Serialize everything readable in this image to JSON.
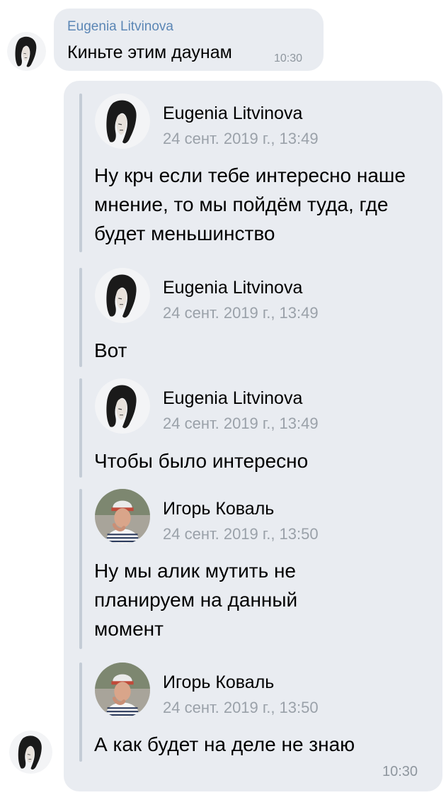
{
  "top_message": {
    "sender": "Eugenia Litvinova",
    "text": "Киньте этим даунам",
    "time": "10:30",
    "avatar_icon": "avatar-woman-photo"
  },
  "forwarded_message": {
    "time": "10:30",
    "items": [
      {
        "name": "Eugenia Litvinova",
        "date": "24 сент. 2019 г., 13:49",
        "text": "Ну крч если тебе интересно наше мнение, то мы пойдём туда, где будет меньшинство",
        "avatar_icon": "avatar-woman-photo"
      },
      {
        "name": "Eugenia Litvinova",
        "date": "24 сент. 2019 г., 13:49",
        "text": "Вот",
        "avatar_icon": "avatar-woman-photo"
      },
      {
        "name": "Eugenia Litvinova",
        "date": "24 сент. 2019 г., 13:49",
        "text": "Чтобы было интересно",
        "avatar_icon": "avatar-woman-photo"
      },
      {
        "name": "Игорь Коваль",
        "date": "24 сент. 2019 г., 13:50",
        "text": "Ну мы алик мутить не планируем на данный момент",
        "avatar_icon": "avatar-man-photo"
      },
      {
        "name": "Игорь Коваль",
        "date": "24 сент. 2019 г., 13:50",
        "text": "А как будет на деле не знаю",
        "avatar_icon": "avatar-man-photo"
      }
    ]
  },
  "colors": {
    "bubble": "#e9ecf1",
    "sender_link": "#5b86b5",
    "meta_gray": "#9aa1a9",
    "forward_bar": "#c4ccd6"
  }
}
